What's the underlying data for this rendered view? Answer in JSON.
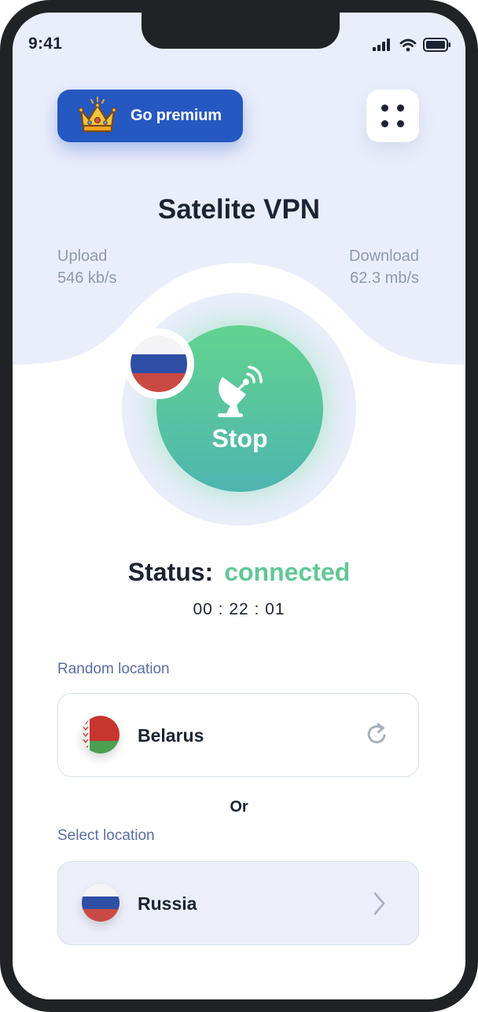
{
  "status_bar": {
    "time": "9:41",
    "icons": [
      "signal-icon",
      "wifi-icon",
      "battery-icon"
    ]
  },
  "header": {
    "premium_label": "Go premium",
    "premium_icon": "crown-icon",
    "menu_icon": "grid-dots-icon"
  },
  "app_title": "Satelite VPN",
  "stats": {
    "upload_label": "Upload",
    "upload_value": "546 kb/s",
    "download_label": "Download",
    "download_value": "62.3 mb/s"
  },
  "connect": {
    "button_label": "Stop",
    "button_icon": "satellite-dish-icon",
    "current_flag": "russia-flag-icon"
  },
  "status": {
    "label": "Status:",
    "value": "connected",
    "timer": "00 : 22 : 01"
  },
  "random_location": {
    "section_label": "Random location",
    "country": "Belarus",
    "flag": "belarus-flag-icon",
    "action_icon": "refresh-icon"
  },
  "or_text": "Or",
  "select_location": {
    "section_label": "Select  location",
    "country": "Russia",
    "flag": "russia-flag-icon",
    "action_icon": "chevron-right-icon"
  },
  "colors": {
    "accent_blue": "#2658c2",
    "connected_green": "#62c796",
    "text_dark": "#1b2433",
    "top_background": "#eaeefb"
  }
}
